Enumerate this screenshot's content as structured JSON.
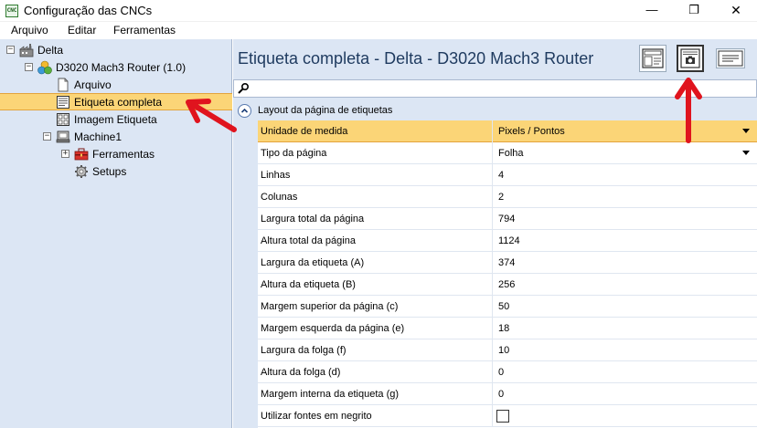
{
  "window": {
    "title": "Configuração das CNCs",
    "app_icon_text": "CNC",
    "minimize_glyph": "—",
    "maximize_glyph": "❐",
    "close_glyph": "✕"
  },
  "menu": {
    "items": [
      "Arquivo",
      "Editar",
      "Ferramentas"
    ]
  },
  "tree": {
    "root": {
      "label": "Delta",
      "expander": "−"
    },
    "router": {
      "label": "D3020 Mach3 Router (1.0)",
      "expander": "−"
    },
    "arquivo": {
      "label": "Arquivo"
    },
    "etiqueta_completa": {
      "label": "Etiqueta completa"
    },
    "imagem_etiqueta": {
      "label": "Imagem Etiqueta"
    },
    "machine": {
      "label": "Machine1",
      "expander": "−"
    },
    "ferramentas": {
      "label": "Ferramentas",
      "expander": "+"
    },
    "setups": {
      "label": "Setups"
    }
  },
  "content": {
    "title": "Etiqueta completa - Delta - D3020 Mach3 Router",
    "group_title": "Layout da página de etiquetas",
    "properties": [
      {
        "name": "Unidade de medida",
        "value": "Pixels / Pontos",
        "type": "dropdown"
      },
      {
        "name": "Tipo da página",
        "value": "Folha",
        "type": "dropdown"
      },
      {
        "name": "Linhas",
        "value": "4",
        "type": "text"
      },
      {
        "name": "Colunas",
        "value": "2",
        "type": "text"
      },
      {
        "name": "Largura total da página",
        "value": "794",
        "type": "text"
      },
      {
        "name": "Altura total da página",
        "value": "1124",
        "type": "text"
      },
      {
        "name": "Largura da etiqueta (A)",
        "value": "374",
        "type": "text"
      },
      {
        "name": "Altura da etiqueta (B)",
        "value": "256",
        "type": "text"
      },
      {
        "name": "Margem superior da página (c)",
        "value": "50",
        "type": "text"
      },
      {
        "name": "Margem esquerda da página (e)",
        "value": "18",
        "type": "text"
      },
      {
        "name": "Largura da folga (f)",
        "value": "10",
        "type": "text"
      },
      {
        "name": "Altura da folga (d)",
        "value": "0",
        "type": "text"
      },
      {
        "name": "Margem interna da etiqueta (g)",
        "value": "0",
        "type": "text"
      },
      {
        "name": "Utilizar fontes em negrito",
        "value": "",
        "type": "checkbox",
        "checked": false
      }
    ]
  },
  "colors": {
    "selection": "#fbd577",
    "pane_bg": "#dce6f4",
    "arrow": "#e0141e"
  }
}
